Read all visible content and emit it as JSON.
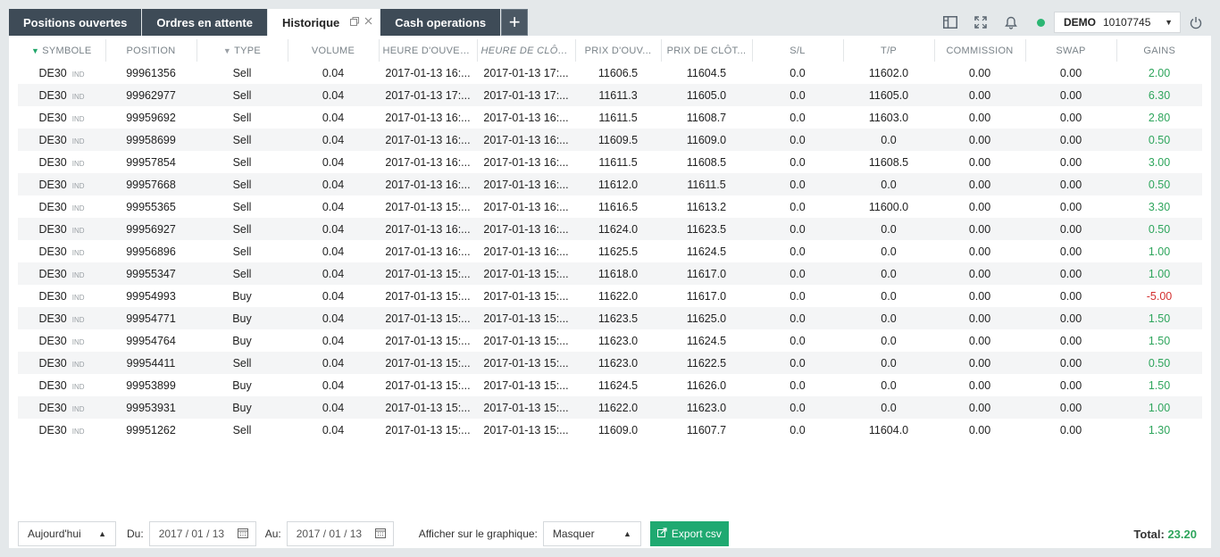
{
  "tabs": [
    {
      "label": "Positions ouvertes",
      "active": false
    },
    {
      "label": "Ordres en attente",
      "active": false
    },
    {
      "label": "Historique",
      "active": true
    },
    {
      "label": "Cash operations",
      "active": false
    }
  ],
  "tab_add_label": "+",
  "account": {
    "type": "DEMO",
    "number": "10107745"
  },
  "columns": [
    "SYMBOLE",
    "POSITION",
    "TYPE",
    "VOLUME",
    "HEURE D'OUVER...",
    "HEURE DE CLÔT...",
    "PRIX D'OUV...",
    "PRIX DE CLÔT...",
    "S/L",
    "T/P",
    "COMMISSION",
    "SWAP",
    "GAINS"
  ],
  "rows": [
    {
      "symbol": "DE30",
      "tag": "IND",
      "position": "99961356",
      "type": "Sell",
      "volume": "0.04",
      "open_time": "2017-01-13 16:...",
      "close_time": "2017-01-13 17:...",
      "open_price": "11606.5",
      "close_price": "11604.5",
      "sl": "0.0",
      "tp": "11602.0",
      "commission": "0.00",
      "swap": "0.00",
      "gain": "2.00"
    },
    {
      "symbol": "DE30",
      "tag": "IND",
      "position": "99962977",
      "type": "Sell",
      "volume": "0.04",
      "open_time": "2017-01-13 17:...",
      "close_time": "2017-01-13 17:...",
      "open_price": "11611.3",
      "close_price": "11605.0",
      "sl": "0.0",
      "tp": "11605.0",
      "commission": "0.00",
      "swap": "0.00",
      "gain": "6.30"
    },
    {
      "symbol": "DE30",
      "tag": "IND",
      "position": "99959692",
      "type": "Sell",
      "volume": "0.04",
      "open_time": "2017-01-13 16:...",
      "close_time": "2017-01-13 16:...",
      "open_price": "11611.5",
      "close_price": "11608.7",
      "sl": "0.0",
      "tp": "11603.0",
      "commission": "0.00",
      "swap": "0.00",
      "gain": "2.80"
    },
    {
      "symbol": "DE30",
      "tag": "IND",
      "position": "99958699",
      "type": "Sell",
      "volume": "0.04",
      "open_time": "2017-01-13 16:...",
      "close_time": "2017-01-13 16:...",
      "open_price": "11609.5",
      "close_price": "11609.0",
      "sl": "0.0",
      "tp": "0.0",
      "commission": "0.00",
      "swap": "0.00",
      "gain": "0.50"
    },
    {
      "symbol": "DE30",
      "tag": "IND",
      "position": "99957854",
      "type": "Sell",
      "volume": "0.04",
      "open_time": "2017-01-13 16:...",
      "close_time": "2017-01-13 16:...",
      "open_price": "11611.5",
      "close_price": "11608.5",
      "sl": "0.0",
      "tp": "11608.5",
      "commission": "0.00",
      "swap": "0.00",
      "gain": "3.00"
    },
    {
      "symbol": "DE30",
      "tag": "IND",
      "position": "99957668",
      "type": "Sell",
      "volume": "0.04",
      "open_time": "2017-01-13 16:...",
      "close_time": "2017-01-13 16:...",
      "open_price": "11612.0",
      "close_price": "11611.5",
      "sl": "0.0",
      "tp": "0.0",
      "commission": "0.00",
      "swap": "0.00",
      "gain": "0.50"
    },
    {
      "symbol": "DE30",
      "tag": "IND",
      "position": "99955365",
      "type": "Sell",
      "volume": "0.04",
      "open_time": "2017-01-13 15:...",
      "close_time": "2017-01-13 16:...",
      "open_price": "11616.5",
      "close_price": "11613.2",
      "sl": "0.0",
      "tp": "11600.0",
      "commission": "0.00",
      "swap": "0.00",
      "gain": "3.30"
    },
    {
      "symbol": "DE30",
      "tag": "IND",
      "position": "99956927",
      "type": "Sell",
      "volume": "0.04",
      "open_time": "2017-01-13 16:...",
      "close_time": "2017-01-13 16:...",
      "open_price": "11624.0",
      "close_price": "11623.5",
      "sl": "0.0",
      "tp": "0.0",
      "commission": "0.00",
      "swap": "0.00",
      "gain": "0.50"
    },
    {
      "symbol": "DE30",
      "tag": "IND",
      "position": "99956896",
      "type": "Sell",
      "volume": "0.04",
      "open_time": "2017-01-13 16:...",
      "close_time": "2017-01-13 16:...",
      "open_price": "11625.5",
      "close_price": "11624.5",
      "sl": "0.0",
      "tp": "0.0",
      "commission": "0.00",
      "swap": "0.00",
      "gain": "1.00"
    },
    {
      "symbol": "DE30",
      "tag": "IND",
      "position": "99955347",
      "type": "Sell",
      "volume": "0.04",
      "open_time": "2017-01-13 15:...",
      "close_time": "2017-01-13 15:...",
      "open_price": "11618.0",
      "close_price": "11617.0",
      "sl": "0.0",
      "tp": "0.0",
      "commission": "0.00",
      "swap": "0.00",
      "gain": "1.00"
    },
    {
      "symbol": "DE30",
      "tag": "IND",
      "position": "99954993",
      "type": "Buy",
      "volume": "0.04",
      "open_time": "2017-01-13 15:...",
      "close_time": "2017-01-13 15:...",
      "open_price": "11622.0",
      "close_price": "11617.0",
      "sl": "0.0",
      "tp": "0.0",
      "commission": "0.00",
      "swap": "0.00",
      "gain": "-5.00"
    },
    {
      "symbol": "DE30",
      "tag": "IND",
      "position": "99954771",
      "type": "Buy",
      "volume": "0.04",
      "open_time": "2017-01-13 15:...",
      "close_time": "2017-01-13 15:...",
      "open_price": "11623.5",
      "close_price": "11625.0",
      "sl": "0.0",
      "tp": "0.0",
      "commission": "0.00",
      "swap": "0.00",
      "gain": "1.50"
    },
    {
      "symbol": "DE30",
      "tag": "IND",
      "position": "99954764",
      "type": "Buy",
      "volume": "0.04",
      "open_time": "2017-01-13 15:...",
      "close_time": "2017-01-13 15:...",
      "open_price": "11623.0",
      "close_price": "11624.5",
      "sl": "0.0",
      "tp": "0.0",
      "commission": "0.00",
      "swap": "0.00",
      "gain": "1.50"
    },
    {
      "symbol": "DE30",
      "tag": "IND",
      "position": "99954411",
      "type": "Sell",
      "volume": "0.04",
      "open_time": "2017-01-13 15:...",
      "close_time": "2017-01-13 15:...",
      "open_price": "11623.0",
      "close_price": "11622.5",
      "sl": "0.0",
      "tp": "0.0",
      "commission": "0.00",
      "swap": "0.00",
      "gain": "0.50"
    },
    {
      "symbol": "DE30",
      "tag": "IND",
      "position": "99953899",
      "type": "Buy",
      "volume": "0.04",
      "open_time": "2017-01-13 15:...",
      "close_time": "2017-01-13 15:...",
      "open_price": "11624.5",
      "close_price": "11626.0",
      "sl": "0.0",
      "tp": "0.0",
      "commission": "0.00",
      "swap": "0.00",
      "gain": "1.50"
    },
    {
      "symbol": "DE30",
      "tag": "IND",
      "position": "99953931",
      "type": "Buy",
      "volume": "0.04",
      "open_time": "2017-01-13 15:...",
      "close_time": "2017-01-13 15:...",
      "open_price": "11622.0",
      "close_price": "11623.0",
      "sl": "0.0",
      "tp": "0.0",
      "commission": "0.00",
      "swap": "0.00",
      "gain": "1.00"
    },
    {
      "symbol": "DE30",
      "tag": "IND",
      "position": "99951262",
      "type": "Sell",
      "volume": "0.04",
      "open_time": "2017-01-13 15:...",
      "close_time": "2017-01-13 15:...",
      "open_price": "11609.0",
      "close_price": "11607.7",
      "sl": "0.0",
      "tp": "11604.0",
      "commission": "0.00",
      "swap": "0.00",
      "gain": "1.30"
    }
  ],
  "footer": {
    "period": "Aujourd'hui",
    "from_label": "Du:",
    "from_date": "2017 / 01 / 13",
    "to_label": "Au:",
    "to_date": "2017 / 01 / 13",
    "chart_label": "Afficher sur le graphique:",
    "chart_option": "Masquer",
    "export_label": "Export csv",
    "total_label": "Total:",
    "total_value": "23.20"
  },
  "colors": {
    "positive": "#2ea55c",
    "negative": "#d32f2f",
    "accent": "#1fa971",
    "tab_bg": "#3e4b57"
  }
}
